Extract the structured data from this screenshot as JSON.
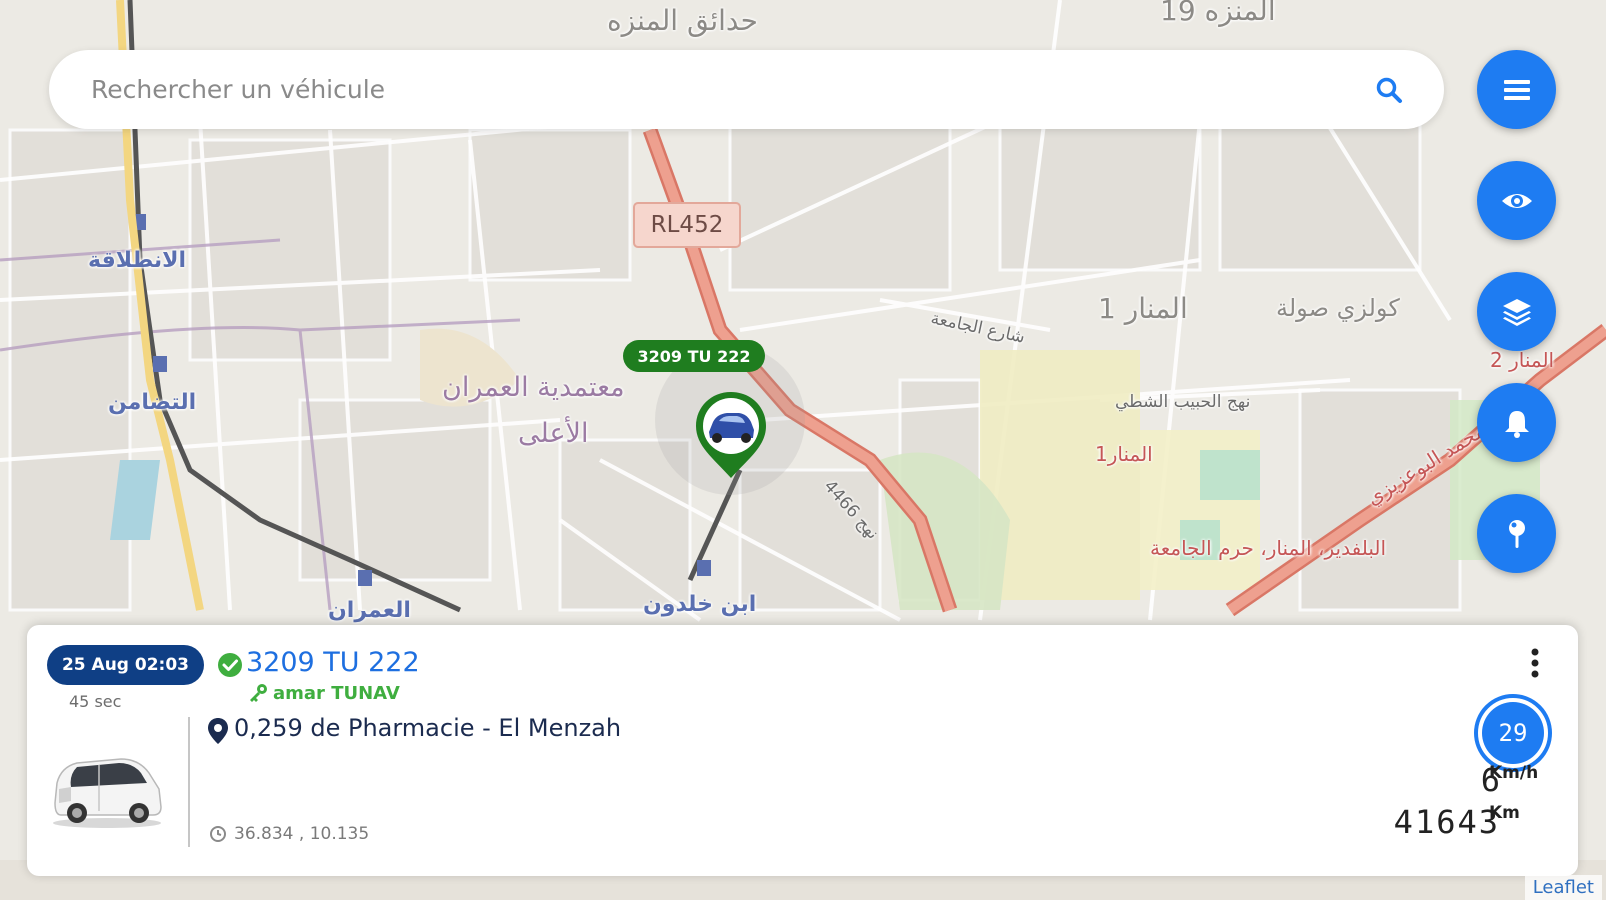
{
  "search": {
    "placeholder": "Rechercher un véhicule"
  },
  "fab_buttons": [
    {
      "id": "menu",
      "icon": "menu-icon"
    },
    {
      "id": "visibility",
      "icon": "eye-icon"
    },
    {
      "id": "layers",
      "icon": "layers-icon"
    },
    {
      "id": "notifications",
      "icon": "bell-icon"
    },
    {
      "id": "poi",
      "icon": "pin-icon"
    }
  ],
  "map": {
    "road_shield": "RL452",
    "labels": {
      "hadaeq_menzah": "حدائق المنزه",
      "menzah_19": "المنزه 19",
      "intilaka": "الانطلاقة",
      "tadhamon": "التضامن",
      "omrane_aala_1": "معتمدية العمران",
      "omrane_aala_2": "الأعلى",
      "manar_1": "المنار 1",
      "colisee_soula": "كولزي صولة",
      "chariaa_jamaa": "شارع الجامعة",
      "habib_chatti": "نهج الحبيب الشطي",
      "manar_1_red": "المنار1",
      "manar_2": "المنار 2",
      "belvedere_campus": "البلفدير، المنار، حرم الجامعة",
      "mohamed_bouazizi": "محمد البوعزيزي",
      "ibn_khaldoun": "ابن خلدون",
      "omrane": "العمران",
      "street_4466": "نهج 4466"
    },
    "marker_plate": "3209 TU 222",
    "attribution": "Leaflet"
  },
  "vehicle": {
    "timestamp": "25 Aug 02:03",
    "elapsed": "45 sec",
    "plate": "3209 TU 222",
    "status": "online",
    "driver": "amar TUNAV",
    "address": "0,259 de Pharmacie - El Menzah",
    "coordinates": "36.834 , 10.135",
    "speed_limit_badge": "29",
    "speed": "6",
    "speed_unit": "Km/h",
    "odometer": "41643",
    "odometer_unit": "Km"
  },
  "colors": {
    "accent": "#1e7cf2",
    "badge_dark_blue": "#0f3f85",
    "plate_tag_green": "#1f7d1f",
    "status_green": "#3fae3f"
  }
}
